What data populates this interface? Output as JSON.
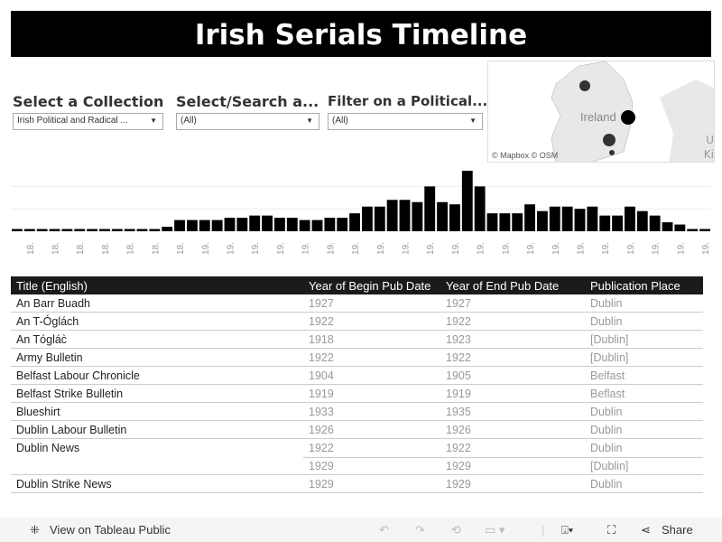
{
  "title": "Irish Serials Timeline",
  "filters": [
    {
      "label": "Select a Collection",
      "value": "Irish Political and Radical ..."
    },
    {
      "label": "Select/Search a...",
      "value": "(All)"
    },
    {
      "label": "Filter on a Political...",
      "value": "(All)"
    }
  ],
  "map": {
    "country_label": "Ireland",
    "edge_labels": [
      "U",
      "Ki"
    ],
    "attribution": "© Mapbox  © OSM"
  },
  "chart_data": {
    "type": "bar",
    "values": [
      1,
      1,
      1,
      1,
      1,
      1,
      1,
      1,
      1,
      1,
      1,
      1,
      2,
      5,
      5,
      5,
      5,
      6,
      6,
      7,
      7,
      6,
      6,
      5,
      5,
      6,
      6,
      8,
      11,
      11,
      14,
      14,
      13,
      20,
      13,
      12,
      27,
      20,
      8,
      8,
      8,
      12,
      9,
      11,
      11,
      10,
      11,
      7,
      7,
      11,
      9,
      7,
      4,
      3,
      1,
      1
    ],
    "tick_labels": [
      "18.",
      "18.",
      "18.",
      "18.",
      "18.",
      "18.",
      "18.",
      "19.",
      "19.",
      "19.",
      "19.",
      "19.",
      "19.",
      "19.",
      "19.",
      "19.",
      "19.",
      "19.",
      "19.",
      "19.",
      "19.",
      "19.",
      "19.",
      "19.",
      "19.",
      "19.",
      "19.",
      "19."
    ],
    "grid": true,
    "color": "#000000"
  },
  "table": {
    "headers": [
      "Title (English)",
      "Year of Begin Pub Date",
      "Year of End Pub Date",
      "Publication Place"
    ],
    "rows": [
      [
        "An Barr Buadh",
        "1927",
        "1927",
        "Dublin"
      ],
      [
        "An T-Óglách",
        "1922",
        "1922",
        "Dublin"
      ],
      [
        "An Tóglác̀",
        "1918",
        "1923",
        "[Dublin]"
      ],
      [
        "Army Bulletin",
        "1922",
        "1922",
        "[Dublin]"
      ],
      [
        "Belfast Labour Chronicle",
        "1904",
        "1905",
        "Belfast"
      ],
      [
        "Belfast Strike Bulletin",
        "1919",
        "1919",
        "Beflast"
      ],
      [
        "Blueshirt",
        "1933",
        "1935",
        "Dublin"
      ],
      [
        "Dublin Labour Bulletin",
        "1926",
        "1926",
        "Dublin"
      ],
      [
        "Dublin News",
        "1922",
        "1922",
        "Dublin"
      ],
      [
        "",
        "1929",
        "1929",
        "[Dublin]"
      ],
      [
        "Dublin Strike News",
        "1929",
        "1929",
        "Dublin"
      ]
    ]
  },
  "footer": {
    "view_label": "View on Tableau Public",
    "share_label": "Share"
  }
}
